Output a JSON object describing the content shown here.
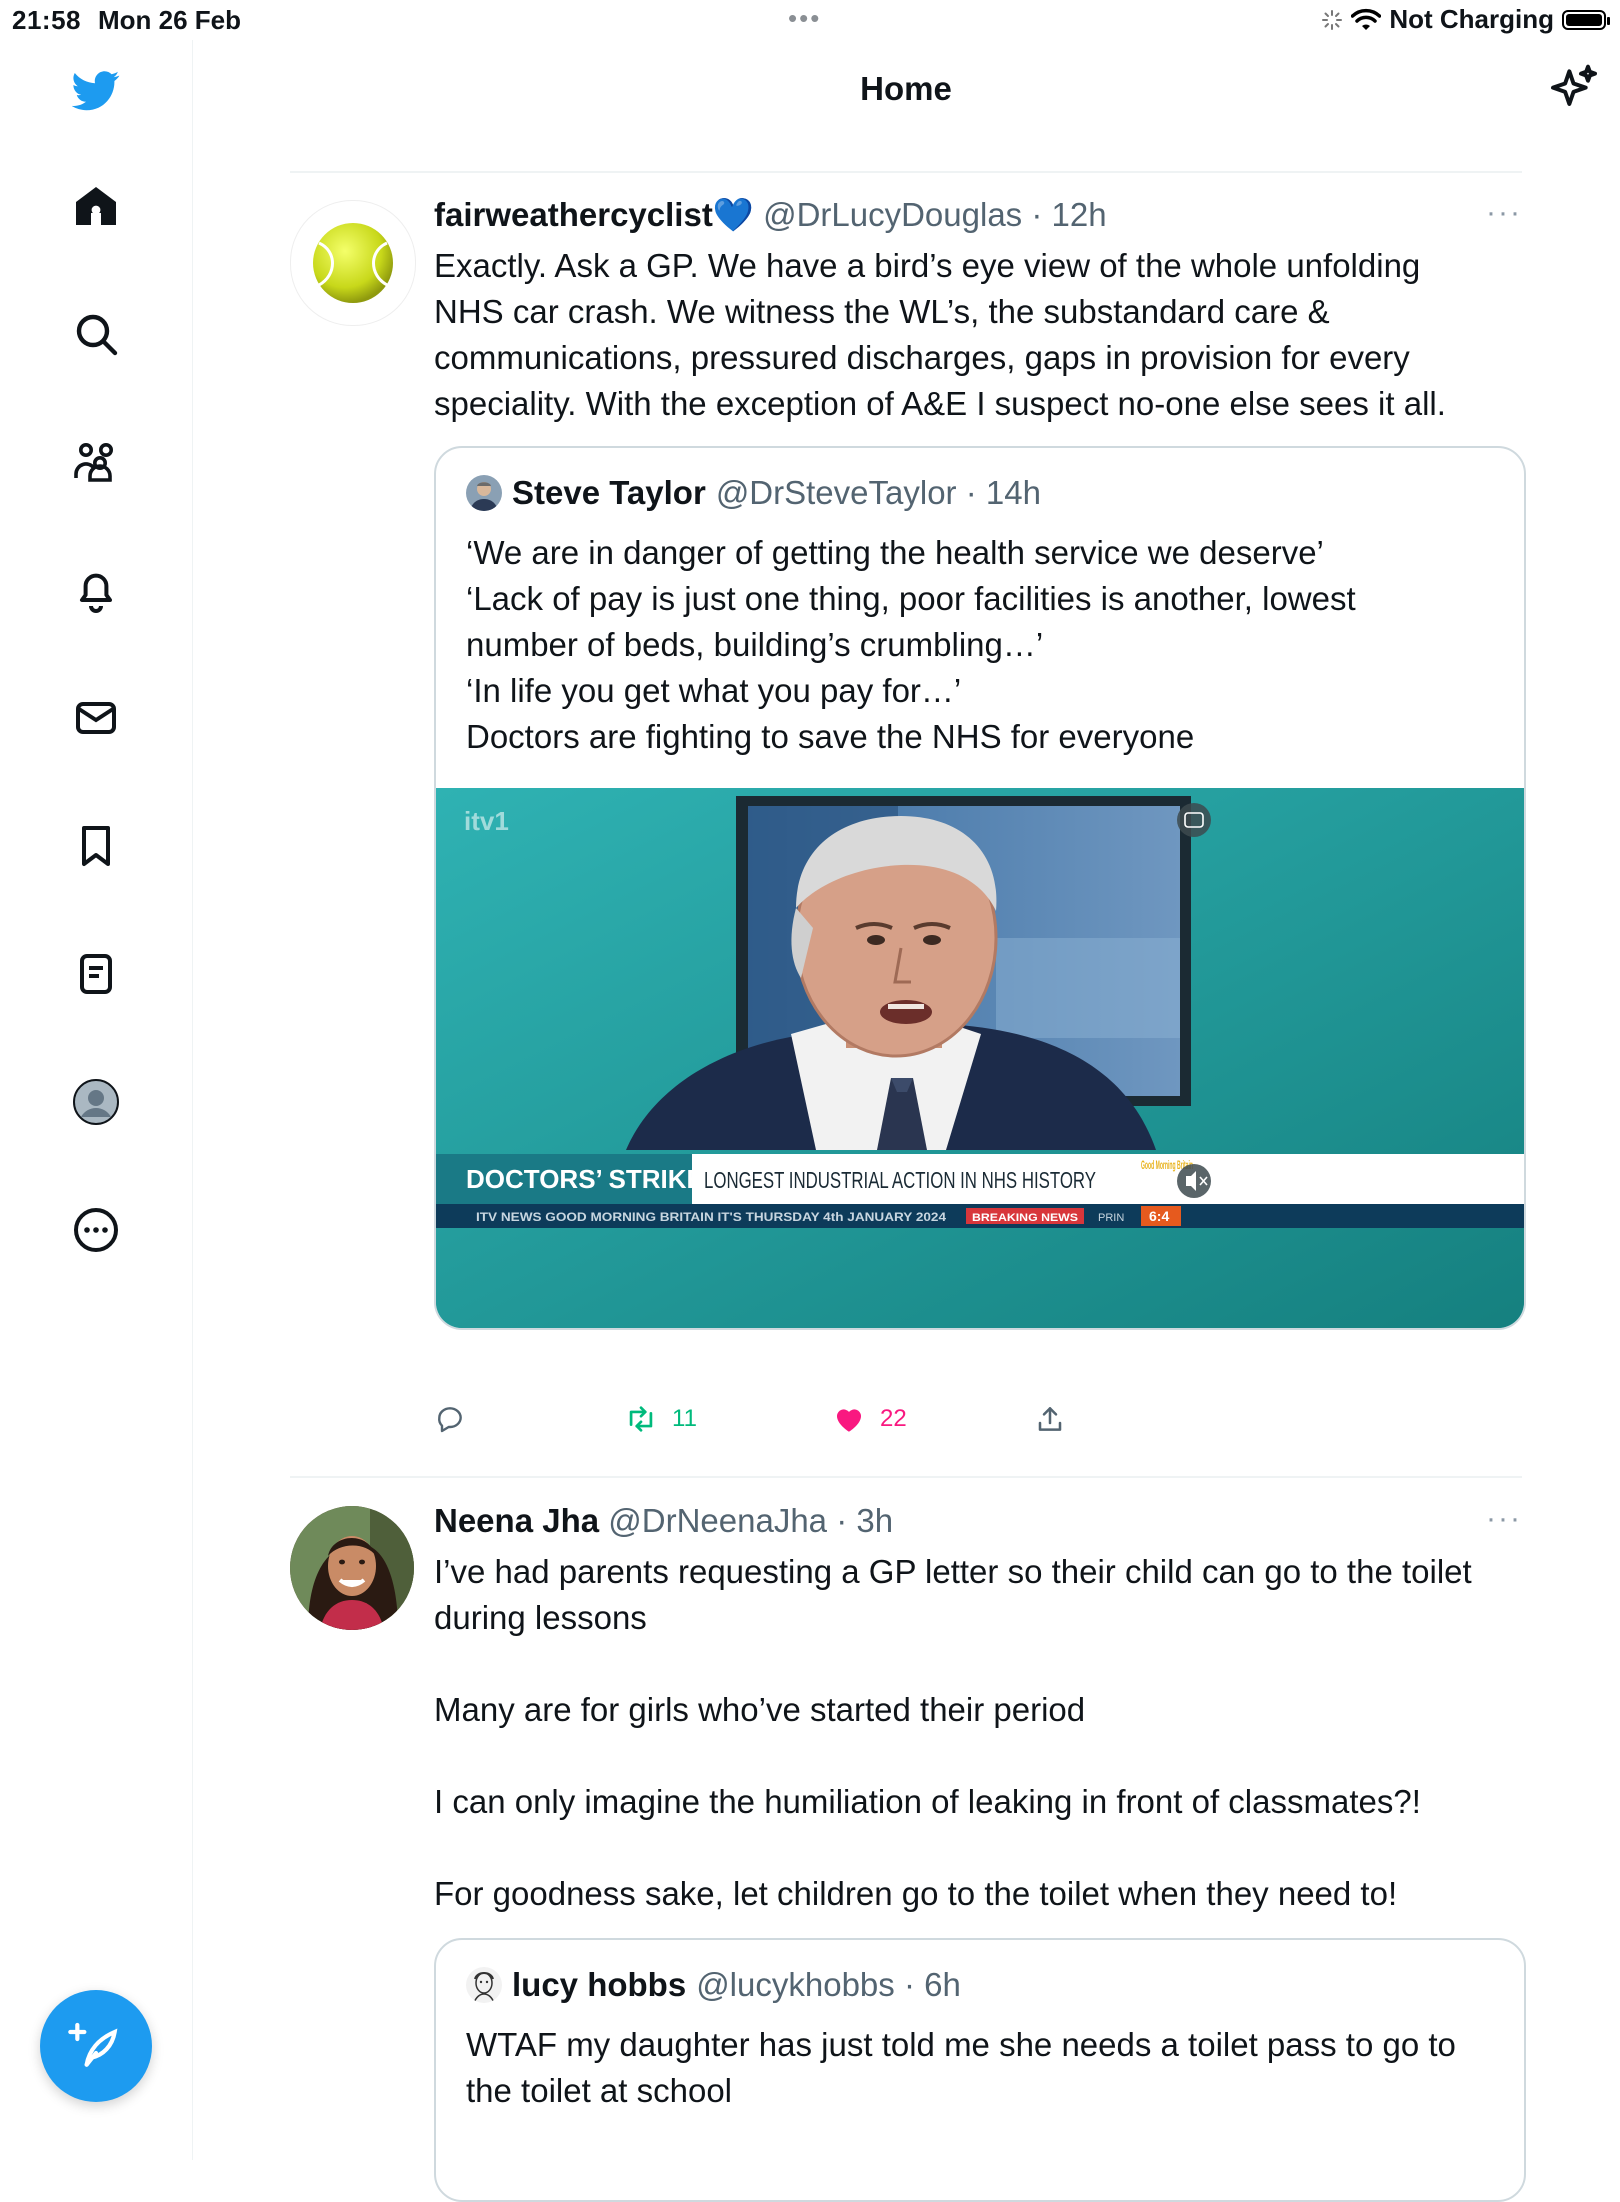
{
  "status_bar": {
    "time": "21:58",
    "date": "Mon 26 Feb",
    "charging": "Not Charging",
    "battery_level": 1.0
  },
  "sidebar": {
    "icons": [
      "twitter-logo-icon",
      "home-icon",
      "search-icon",
      "communities-icon",
      "notifications-icon",
      "messages-icon",
      "bookmarks-icon",
      "lists-icon",
      "profile-icon",
      "more-icon"
    ],
    "compose_icon": "compose-tweet-icon"
  },
  "header": {
    "title": "Home",
    "icon": "sparkle-icon"
  },
  "colors": {
    "accent": "#1d9bf0",
    "retweet": "#00ba7c",
    "like": "#f91880",
    "meta": "#536471"
  },
  "tweets": [
    {
      "name": "fairweathercyclist",
      "emoji": "💙",
      "handle": "@DrLucyDouglas",
      "time": "12h",
      "text": "Exactly. Ask a GP. We have a bird’s eye view of the whole unfolding\nNHS car crash. We witness the WL’s, the substandard care &\ncommunications, pressured discharges, gaps in provision for every\nspeciality. With the exception of A&E I suspect no-one else sees it all.",
      "quote": {
        "name": "Steve Taylor",
        "handle": "@DrSteveTaylor",
        "time": "14h",
        "text": "‘We are in danger of getting the health service we deserve’\n‘Lack of pay is just one thing, poor facilities is another, lowest\nnumber of beds, building’s crumbling…’\n‘In life you get what you pay for…’\nDoctors are fighting to save the NHS for everyone",
        "video": {
          "channel": "itv1",
          "strap_left": "DOCTORS’ STRIKE",
          "strap_right": "LONGEST INDUSTRIAL ACTION IN NHS HISTORY",
          "show_logo": "Good Morning Britain",
          "ticker": "ITV NEWS   GOOD MORNING BRITAIN IT'S THURSDAY 4th JANUARY 2024",
          "ticker_badge": "BREAKING NEWS",
          "ticker_extra": "PRIN",
          "clock": "6:4"
        }
      },
      "retweets": "11",
      "likes": "22"
    },
    {
      "name": "Neena Jha",
      "handle": "@DrNeenaJha",
      "time": "3h",
      "text": "I’ve had parents requesting a GP letter so their child can go to the toilet\nduring lessons\n\nMany are for girls who’ve started their period\n\nI can only imagine the humiliation of leaking in front of classmates?!\n\nFor goodness sake, let children go to the toilet when they need to!",
      "quote": {
        "name": "lucy hobbs",
        "handle": "@lucykhobbs",
        "time": "6h",
        "text": "WTAF my daughter has just told me she needs a toilet pass to go to\nthe toilet at school"
      }
    }
  ],
  "meta_sep": "·",
  "more_label": "···"
}
